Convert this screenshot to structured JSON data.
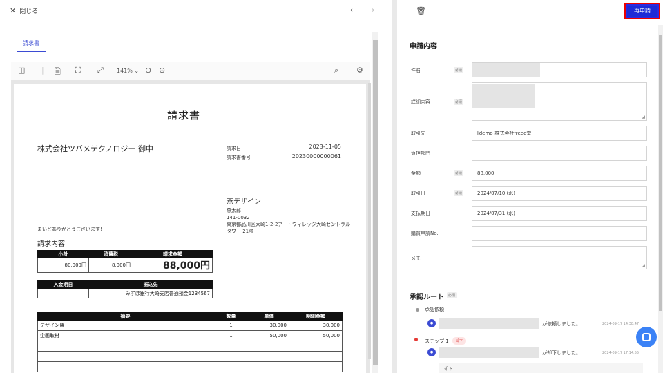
{
  "left": {
    "close_label": "閉じる",
    "nav_prev": "←",
    "nav_next": "→",
    "tab_label": "請求書",
    "zoom": "141%",
    "invoice": {
      "title": "請求書",
      "client": "株式会社ツバメテクノロジー 御中",
      "date_label": "請求日",
      "date_value": "2023-11-05",
      "number_label": "請求書番号",
      "number_value": "20230000000061",
      "sender_name": "燕デザイン",
      "sender_person": "燕太郎",
      "sender_zip": "141-0032",
      "sender_address": "東京都品川区大崎1-2-2アートヴィレッジ大崎セントラルタワー 21階",
      "thanks": "まいどありがとうございます!",
      "content_label": "請求内容",
      "summary_headers": [
        "小計",
        "消費税",
        "請求金額"
      ],
      "summary_values": [
        "80,000円",
        "8,000円",
        "88,000円"
      ],
      "payment_headers": [
        "入金期日",
        "振込先"
      ],
      "payment_values": [
        "",
        "みずほ銀行大崎支店普通預金1234567"
      ],
      "item_headers": [
        "摘要",
        "数量",
        "単価",
        "明細金額"
      ],
      "items": [
        [
          "デザイン費",
          "1",
          "30,000",
          "30,000"
        ],
        [
          "企画取材",
          "1",
          "50,000",
          "50,000"
        ],
        [
          "",
          "",
          "",
          ""
        ],
        [
          "",
          "",
          "",
          ""
        ],
        [
          "",
          "",
          "",
          ""
        ]
      ]
    }
  },
  "right": {
    "reapply_label": "再申請",
    "section_title": "申請内容",
    "required_label": "必須",
    "fields": {
      "subject": "件名",
      "detail": "詳細内容",
      "partner": "取引先",
      "partner_value": "[demo]株式会社freee堂",
      "department": "負担部門",
      "amount": "金額",
      "amount_value": "88,000",
      "txn_date": "取引日",
      "txn_date_value": "2024/07/10 (水)",
      "due_date": "支払期日",
      "due_date_value": "2024/07/31 (水)",
      "purchase_no": "購買申請No.",
      "memo": "メモ"
    },
    "route": {
      "title": "承認ルート",
      "request_label": "承認依頼",
      "requested_text": "が依頼しました。",
      "requested_ts": "2024-09-17 14:38:47",
      "step_label": "ステップ 1",
      "step_badge": "却下",
      "rejected_text": "が却下しました。",
      "rejected_ts": "2024-09-17 17:14:55",
      "comment": "却下"
    }
  }
}
